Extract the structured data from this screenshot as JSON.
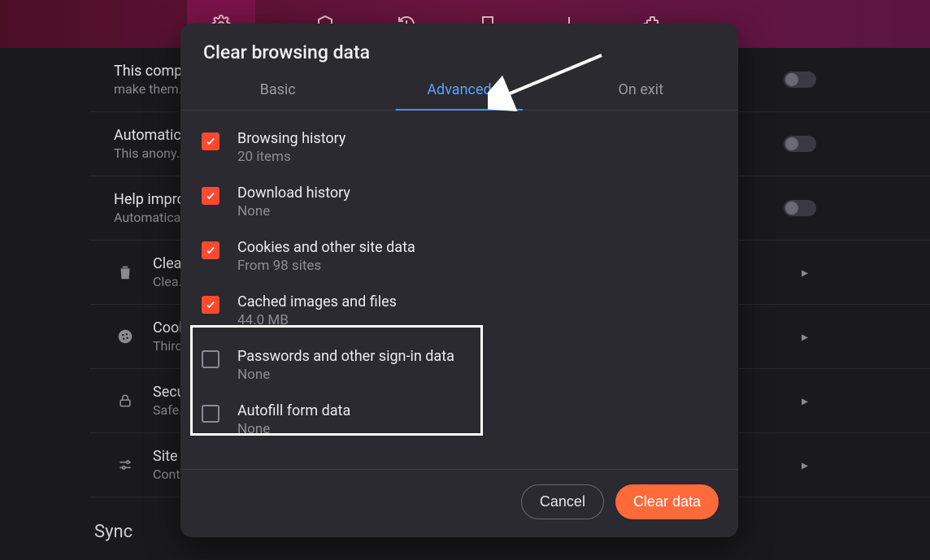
{
  "background": {
    "rows": [
      {
        "icon": "",
        "t1": "This compl…",
        "t2": "make them…",
        "toggle": true,
        "chev": false
      },
      {
        "icon": "",
        "t1": "Automatica…",
        "t2": "This anony…",
        "toggle": true,
        "chev": false
      },
      {
        "icon": "",
        "t1": "Help impro…",
        "t2": "Automatica…",
        "toggle": true,
        "chev": false
      },
      {
        "icon": "trash",
        "t1": "Clea…",
        "t2": "Clea…",
        "toggle": false,
        "chev": true
      },
      {
        "icon": "cookie",
        "t1": "Cook…",
        "t2": "Third…",
        "toggle": false,
        "chev": true
      },
      {
        "icon": "lock",
        "t1": "Secu…",
        "t2": "Safe…",
        "toggle": false,
        "chev": true
      },
      {
        "icon": "sliders",
        "t1": "Site …",
        "t2": "Cont…",
        "toggle": false,
        "chev": true
      }
    ],
    "sync_heading": "Sync"
  },
  "modal": {
    "title": "Clear browsing data",
    "tabs": {
      "basic": "Basic",
      "advanced": "Advanced",
      "onexit": "On exit"
    },
    "active_tab": "advanced",
    "options": [
      {
        "id": "browsing-history",
        "checked": true,
        "label": "Browsing history",
        "sub": "20 items"
      },
      {
        "id": "download-history",
        "checked": true,
        "label": "Download history",
        "sub": "None"
      },
      {
        "id": "cookies",
        "checked": true,
        "label": "Cookies and other site data",
        "sub": "From 98 sites"
      },
      {
        "id": "cache",
        "checked": true,
        "label": "Cached images and files",
        "sub": "44.0 MB"
      },
      {
        "id": "passwords",
        "checked": false,
        "label": "Passwords and other sign-in data",
        "sub": "None"
      },
      {
        "id": "autofill",
        "checked": false,
        "label": "Autofill form data",
        "sub": "None"
      }
    ],
    "buttons": {
      "cancel": "Cancel",
      "clear": "Clear data"
    }
  }
}
